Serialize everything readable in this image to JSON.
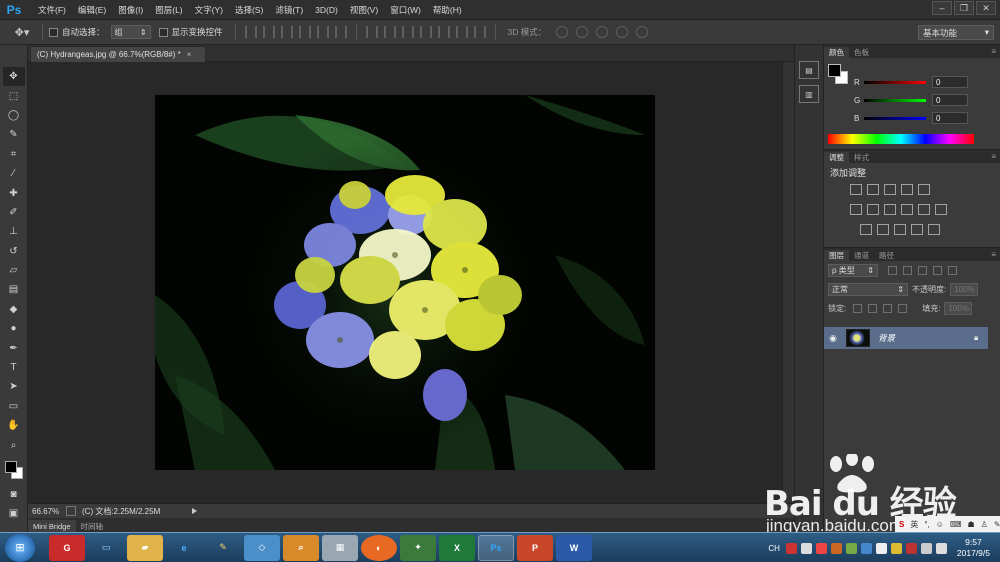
{
  "app": {
    "logo": "Ps"
  },
  "menu": [
    "文件(F)",
    "编辑(E)",
    "图像(I)",
    "图层(L)",
    "文字(Y)",
    "选择(S)",
    "滤镜(T)",
    "3D(D)",
    "视图(V)",
    "窗口(W)",
    "帮助(H)"
  ],
  "options": {
    "auto_select_label": "自动选择：",
    "auto_select_value": "组",
    "show_transform_label": "显示变换控件",
    "mode3d_label": "3D 模式：",
    "workspace": "基本功能"
  },
  "document": {
    "tab_title": "(C) Hydrangeas.jpg @ 66.7%(RGB/8#) *",
    "zoom": "66.67%",
    "doc_info": "(C) 文档:2.25M/2.25M"
  },
  "bottom_tabs": [
    "Mini Bridge",
    "时间轴"
  ],
  "color_panel": {
    "tabs": [
      "颜色",
      "色板"
    ],
    "channels": [
      {
        "letter": "R",
        "value": "0",
        "color": "#e02020"
      },
      {
        "letter": "G",
        "value": "0",
        "color": "#20c020"
      },
      {
        "letter": "B",
        "value": "0",
        "color": "#2030e0"
      }
    ]
  },
  "adjust_panel": {
    "tabs": [
      "调整",
      "样式"
    ],
    "title": "添加调整"
  },
  "layers_panel": {
    "tabs": [
      "图层",
      "通道",
      "路径"
    ],
    "filter_kind": "ρ 类型",
    "blend_mode": "正常",
    "opacity_label": "不透明度:",
    "opacity_value": "100%",
    "lock_label": "锁定:",
    "fill_label": "填充:",
    "fill_value": "100%",
    "layer_name": "背景"
  },
  "taskbar": {
    "lang": "CH",
    "time": "9:57",
    "date": "2017/9/5",
    "apps": [
      "app-red",
      "app-monitor",
      "app-folder",
      "app-ie",
      "app-paint",
      "app-blue",
      "app-search",
      "app-calc",
      "app-firefox",
      "app-puzzle",
      "app-excel",
      "app-ps",
      "app-ppt",
      "app-word"
    ]
  },
  "watermark": {
    "main": "Bai du 经验",
    "sub": "jingyan.baidu.com",
    "badge": "英"
  }
}
